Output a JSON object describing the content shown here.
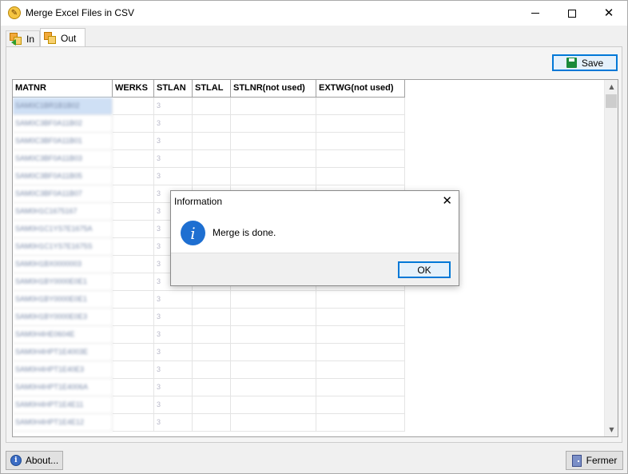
{
  "window": {
    "title": "Merge Excel Files in CSV",
    "app_icon_glyph": "✎"
  },
  "tabs": [
    {
      "label": "In"
    },
    {
      "label": "Out"
    }
  ],
  "toolbar": {
    "save_label": "Save"
  },
  "grid": {
    "columns": [
      "MATNR",
      "WERKS",
      "STLAN",
      "STLAL",
      "STLNR(not used)",
      "EXTWG(not used)"
    ],
    "rows": [
      [
        "SAM0C1BR1B1B02",
        "",
        "3",
        "",
        "",
        ""
      ],
      [
        "SAM0C3BF0A11B02",
        "",
        "3",
        "",
        "",
        ""
      ],
      [
        "SAM0C3BF0A11B01",
        "",
        "3",
        "",
        "",
        ""
      ],
      [
        "SAM0C3BF0A11B03",
        "",
        "3",
        "",
        "",
        ""
      ],
      [
        "SAM0C3BF0A11B05",
        "",
        "3",
        "",
        "",
        ""
      ],
      [
        "SAM0C3BF0A11B07",
        "",
        "3",
        "",
        "",
        ""
      ],
      [
        "SAM0H1C1675167",
        "",
        "3",
        "",
        "",
        ""
      ],
      [
        "SAM0H1C1YS7E1675A",
        "",
        "3",
        "",
        "",
        ""
      ],
      [
        "SAM0H1C1YS7E1675S",
        "",
        "3",
        "",
        "",
        ""
      ],
      [
        "SAM0H1BX0000003",
        "",
        "3",
        "",
        "",
        ""
      ],
      [
        "SAM0H1BY0000E0E1",
        "",
        "3",
        "",
        "",
        ""
      ],
      [
        "SAM0H1BY0000E0E1",
        "",
        "3",
        "",
        "",
        ""
      ],
      [
        "SAM0H1BY0000E0E3",
        "",
        "3",
        "",
        "",
        ""
      ],
      [
        "SAM0H4HE0604E",
        "",
        "3",
        "",
        "",
        ""
      ],
      [
        "SAM0H4HPT1E4003E",
        "",
        "3",
        "",
        "",
        ""
      ],
      [
        "SAM0H4HPT1E40E3",
        "",
        "3",
        "",
        "",
        ""
      ],
      [
        "SAM0H4HPT1E4006A",
        "",
        "3",
        "",
        "",
        ""
      ],
      [
        "SAM0H4HPT1E4E11",
        "",
        "3",
        "",
        "",
        ""
      ],
      [
        "SAM0H4HPT1E4E12",
        "",
        "3",
        "",
        "",
        ""
      ]
    ]
  },
  "footer": {
    "about_label": "About...",
    "close_label": "Fermer"
  },
  "dialog": {
    "title": "Information",
    "message": "Merge is done.",
    "ok_label": "OK"
  }
}
